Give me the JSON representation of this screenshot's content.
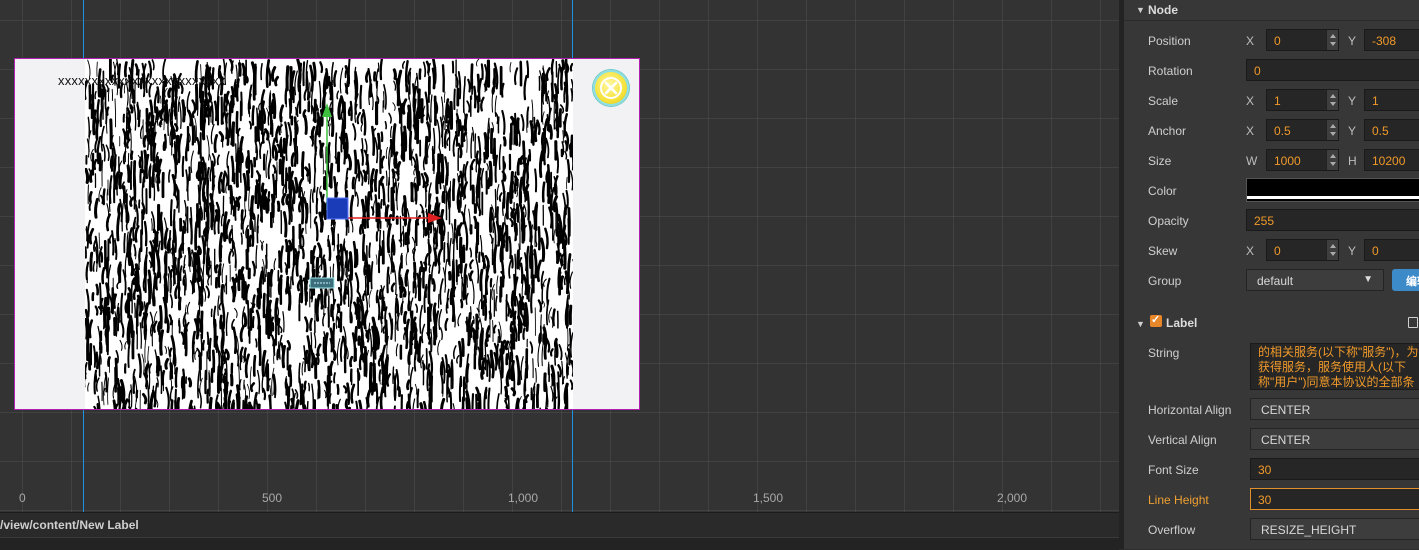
{
  "scene": {
    "label_text": "xxxxxxxxxxxxxxxxxxxxxxxxx",
    "ruler_ticks": [
      "0",
      "500",
      "1,000",
      "1,500",
      "2,000"
    ],
    "top_text": "…"
  },
  "pathbar": {
    "path": "/view/content/New Label"
  },
  "inspector": {
    "node_section": "Node",
    "position": {
      "label": "Position",
      "x_axis": "X",
      "x": "0",
      "y_axis": "Y",
      "y": "-308"
    },
    "rotation": {
      "label": "Rotation",
      "value": "0"
    },
    "scale": {
      "label": "Scale",
      "x_axis": "X",
      "x": "1",
      "y_axis": "Y",
      "y": "1"
    },
    "anchor": {
      "label": "Anchor",
      "x_axis": "X",
      "x": "0.5",
      "y_axis": "Y",
      "y": "0.5"
    },
    "size": {
      "label": "Size",
      "w_axis": "W",
      "w": "1000",
      "h_axis": "H",
      "h": "10200"
    },
    "color": {
      "label": "Color",
      "value": "#000000"
    },
    "opacity": {
      "label": "Opacity",
      "value": "255"
    },
    "skew": {
      "label": "Skew",
      "x_axis": "X",
      "x": "0",
      "y_axis": "Y",
      "y": "0"
    },
    "group": {
      "label": "Group",
      "value": "default",
      "edit_button": "编辑"
    },
    "label_section": "Label",
    "string": {
      "label": "String",
      "lines": [
        "的相关服务(以下称\"服务\")，为",
        "获得服务，服务使用人(以下",
        "称\"用户\")同意本协议的全部条"
      ]
    },
    "horizontal_align": {
      "label": "Horizontal Align",
      "value": "CENTER"
    },
    "vertical_align": {
      "label": "Vertical Align",
      "value": "CENTER"
    },
    "font_size": {
      "label": "Font Size",
      "value": "30"
    },
    "line_height": {
      "label": "Line Height",
      "value": "30"
    },
    "overflow": {
      "label": "Overflow",
      "value": "RESIZE_HEIGHT"
    }
  }
}
